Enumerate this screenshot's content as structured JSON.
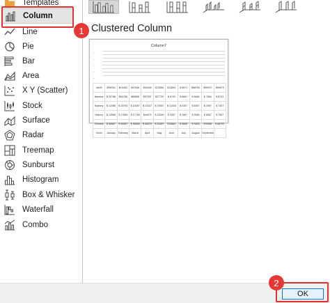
{
  "sidebar": {
    "partial_item": {
      "label": "Templates",
      "icon": "folder-icon"
    },
    "items": [
      {
        "label": "Column",
        "icon": "column-chart-icon",
        "selected": true
      },
      {
        "label": "Line",
        "icon": "line-chart-icon"
      },
      {
        "label": "Pie",
        "icon": "pie-chart-icon"
      },
      {
        "label": "Bar",
        "icon": "bar-chart-icon"
      },
      {
        "label": "Area",
        "icon": "area-chart-icon"
      },
      {
        "label": "X Y (Scatter)",
        "icon": "scatter-chart-icon"
      },
      {
        "label": "Stock",
        "icon": "stock-chart-icon"
      },
      {
        "label": "Surface",
        "icon": "surface-chart-icon"
      },
      {
        "label": "Radar",
        "icon": "radar-chart-icon"
      },
      {
        "label": "Treemap",
        "icon": "treemap-chart-icon"
      },
      {
        "label": "Sunburst",
        "icon": "sunburst-chart-icon"
      },
      {
        "label": "Histogram",
        "icon": "histogram-chart-icon"
      },
      {
        "label": "Box & Whisker",
        "icon": "box-whisker-chart-icon"
      },
      {
        "label": "Waterfall",
        "icon": "waterfall-chart-icon"
      },
      {
        "label": "Combo",
        "icon": "combo-chart-icon"
      }
    ]
  },
  "subtypes": {
    "selected_index": 0,
    "count": 6
  },
  "main": {
    "subtype_title": "Clustered Column",
    "preview": {
      "title": "Column7",
      "rows": [
        [
          "Jan'B",
          "$39034",
          "$15363",
          "$37936",
          "$54269",
          "$13565",
          "$13663",
          "$ 0671",
          "$58760",
          "$90970",
          "$90675"
        ],
        [
          "Banana",
          "$ 34788",
          "$54768",
          "$56898",
          "$57087",
          "$37739",
          "$ 6753",
          "$ 6681",
          "$ 5689",
          "$ 7684",
          "$ 8743"
        ],
        [
          "Mystery",
          "$ 13358",
          "$ 15753",
          "$ 15357",
          "$ 13337",
          "$ 15357",
          "$ 13334",
          "$ 0357",
          "$ 6357",
          "$ 3557",
          "$ 7357"
        ],
        [
          "Hickory",
          "$ 13568",
          "$ 17646",
          "$ 17765",
          "$44679",
          "$ 15346",
          "$ 0357",
          "$ 1567",
          "$ 3546",
          "$ 6567",
          "$ 7567"
        ],
        [
          "Chrislan",
          "$ 56587",
          "$ 54587",
          "$ 56580",
          "$ 56579",
          "$ 51587",
          "$78881",
          "$ 3685",
          "$ 3483",
          "$76984",
          "$ 68793"
        ],
        [
          "Vivoh",
          "January",
          "February",
          "March",
          "April",
          "May",
          "June",
          "July",
          "August",
          "September",
          ""
        ]
      ]
    }
  },
  "footer": {
    "ok_label": "OK"
  },
  "callouts": {
    "step1": "1",
    "step2": "2"
  },
  "colors": {
    "callout": "#e53935",
    "selected_bg": "#e4e4e4",
    "ok_border": "#0078d7"
  }
}
